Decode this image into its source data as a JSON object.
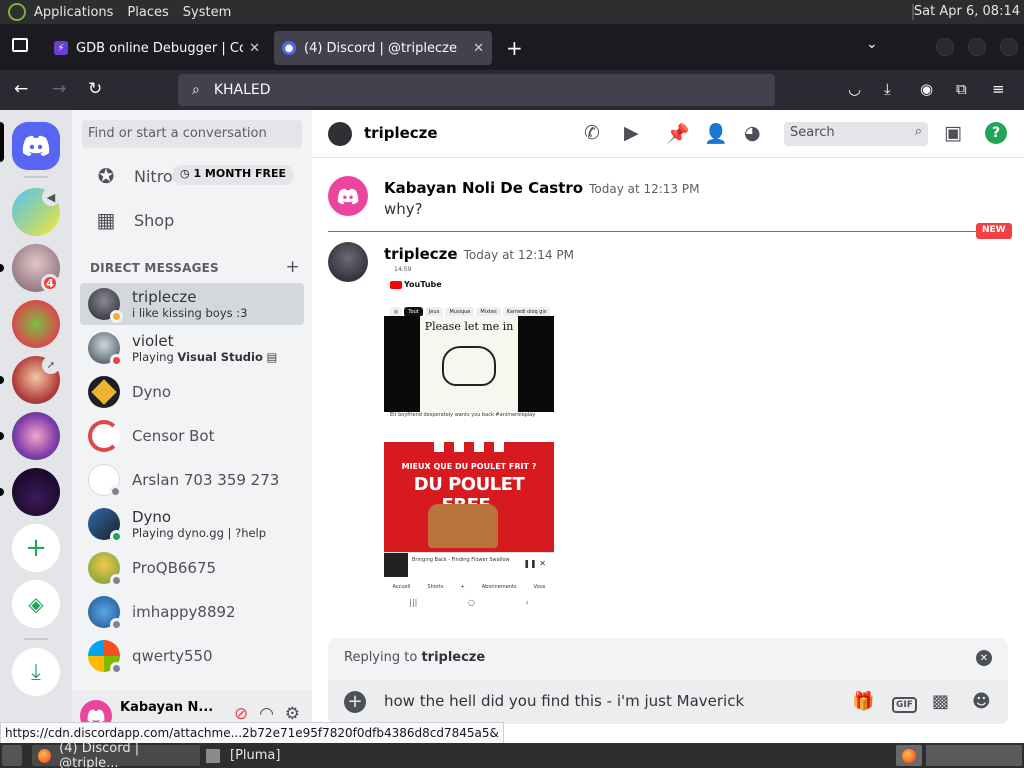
{
  "os": {
    "menus": [
      "Applications",
      "Places",
      "System"
    ],
    "clock": "Sat Apr  6, 08:14"
  },
  "browser": {
    "tabs": [
      {
        "title": "GDB online Debugger | Com",
        "active": false
      },
      {
        "title": "(4) Discord | @triplecze",
        "active": true
      }
    ],
    "url": "KHALED",
    "status_url": "https://cdn.discordapp.com/attachme...2b72e71e95f7820f0dfb4386d8cd7845a5&"
  },
  "discord": {
    "guild_badge": "4",
    "search_placeholder": "Find or start a conversation",
    "nitro": {
      "label": "Nitro",
      "badge": "1 MONTH FREE"
    },
    "shop": {
      "label": "Shop"
    },
    "dm_header": "DIRECT MESSAGES",
    "dms": [
      {
        "name": "triplecze",
        "sub": "i like kissing boys :3",
        "status": "idle"
      },
      {
        "name": "violet",
        "sub_prefix": "Playing ",
        "sub_bold": "Visual Studio",
        "status": "dnd"
      },
      {
        "name": "Dyno",
        "sub": "",
        "status": "none"
      },
      {
        "name": "Censor Bot",
        "sub": "",
        "status": "none"
      },
      {
        "name": "Arslan 703 359 273",
        "sub": "",
        "status": "off"
      },
      {
        "name": "Dyno",
        "sub": "Playing dyno.gg | ?help",
        "status": "on"
      },
      {
        "name": "ProQB6675",
        "sub": "",
        "status": "off"
      },
      {
        "name": "imhappy8892",
        "sub": "",
        "status": "off"
      },
      {
        "name": "qwerty550",
        "sub": "",
        "status": "off"
      }
    ],
    "user": {
      "name": "Kabayan N..."
    },
    "chat": {
      "header": "triplecze",
      "search": "Search",
      "messages": [
        {
          "author": "Kabayan Noli De Castro",
          "time": "Today at 12:13 PM",
          "text": "why?"
        },
        {
          "author": "triplecze",
          "time": "Today at 12:14 PM",
          "text": ""
        }
      ],
      "new_label": "NEW",
      "attachment": {
        "status_time": "14:59",
        "yt_label": "YouTube",
        "chips": [
          "Tout",
          "Jeux",
          "Musique",
          "Mixtes",
          "Kamedi oloq gis"
        ],
        "video_caption": "Please let me in",
        "video_title": "Eit boyfriend desperately wants you back #animeroleplay",
        "ad_line1": "MIEUX QUE DU POULET FRIT ?",
        "ad_line2": "DU POULET FREE.",
        "mini_title": "Bringing Back - Finding Flower Swallow",
        "nav": [
          "Accueil",
          "Shorts",
          "+",
          "Abonnements",
          "Vous"
        ]
      },
      "reply": {
        "prefix": "Replying to ",
        "to": "triplecze"
      },
      "composer_text": "how the hell did you find this - i'm just Maverick"
    }
  },
  "taskbar": {
    "items": [
      "(4) Discord | @triple...",
      "[Pluma]"
    ]
  }
}
